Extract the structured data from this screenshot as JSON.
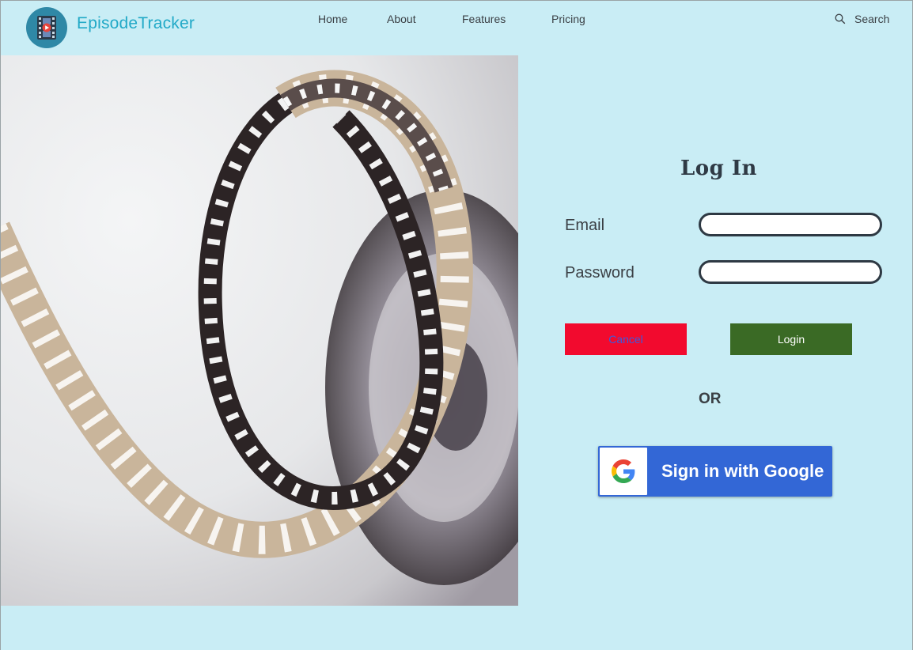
{
  "header": {
    "brand": "EpisodeTracker",
    "nav": [
      {
        "label": "Home"
      },
      {
        "label": "About"
      },
      {
        "label": "Features"
      },
      {
        "label": "Pricing"
      }
    ],
    "search_label": "Search",
    "search_icon": "search-icon",
    "logo_icon": "film-play-icon"
  },
  "hero": {
    "image": "film-reel-photo"
  },
  "login": {
    "title": "Log In",
    "email_label": "Email",
    "email_value": "",
    "password_label": "Password",
    "password_value": "",
    "cancel_label": "Cancel",
    "login_label": "Login",
    "or_text": "OR",
    "google_label": "Sign in with Google",
    "google_icon": "google-g-icon"
  },
  "colors": {
    "background": "#c9edf5",
    "brand": "#22a9c7",
    "cancel_bg": "#f20a2e",
    "cancel_text": "#3b5bdf",
    "login_bg": "#3a6a25",
    "google_bg": "#3367d6"
  }
}
